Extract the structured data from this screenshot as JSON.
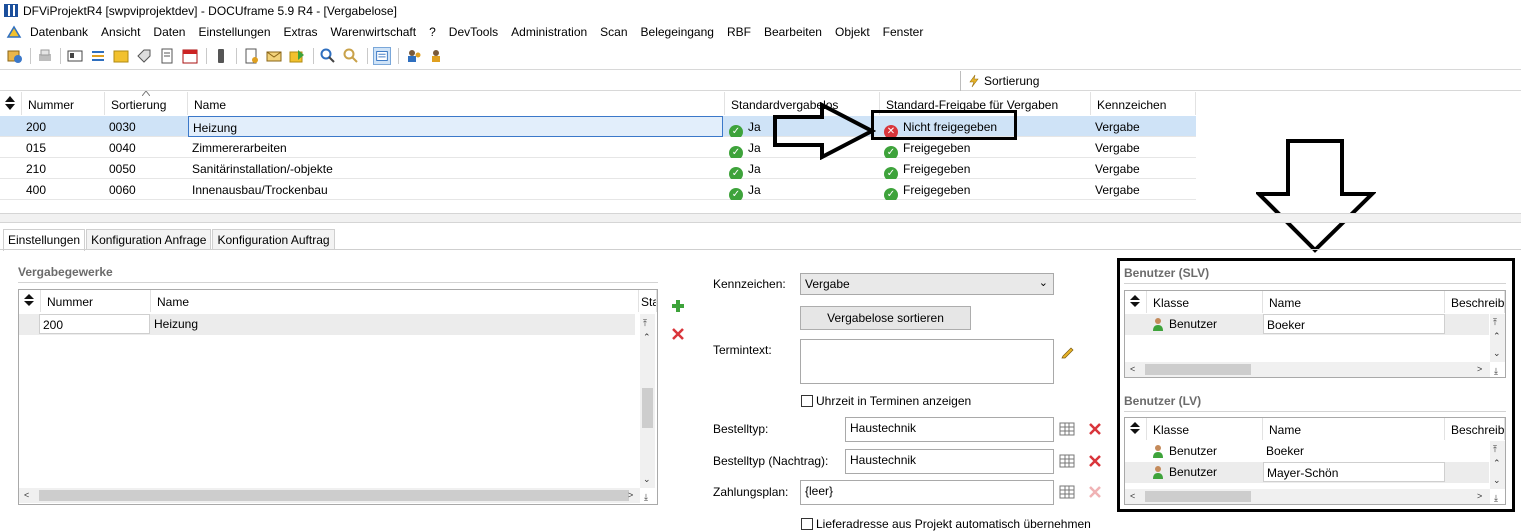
{
  "window": {
    "title": "DFViProjektR4 [swpviprojektdev] - DOCUframe 5.9 R4 - [Vergabelose]"
  },
  "menu": [
    "Datenbank",
    "Ansicht",
    "Daten",
    "Einstellungen",
    "Extras",
    "Warenwirtschaft",
    "?",
    "DevTools",
    "Administration",
    "Scan",
    "Belegeingang",
    "RBF",
    "Bearbeiten",
    "Objekt",
    "Fenster"
  ],
  "sortbar": {
    "label": "Sortierung"
  },
  "grid": {
    "columns": [
      "Nummer",
      "Sortierung",
      "Name",
      "Standardvergabelos",
      "Standard-Freigabe für Vergaben",
      "Kennzeichen"
    ],
    "rows": [
      {
        "nummer": "200",
        "sortierung": "0030",
        "name": "Heizung",
        "std": "Ja",
        "freigabe": "Nicht freigegeben",
        "kennzeichen": "Vergabe"
      },
      {
        "nummer": "015",
        "sortierung": "0040",
        "name": "Zimmererarbeiten",
        "std": "Ja",
        "freigabe": "Freigegeben",
        "kennzeichen": "Vergabe"
      },
      {
        "nummer": "210",
        "sortierung": "0050",
        "name": "Sanitärinstallation/-objekte",
        "std": "Ja",
        "freigabe": "Freigegeben",
        "kennzeichen": "Vergabe"
      },
      {
        "nummer": "400",
        "sortierung": "0060",
        "name": "Innenausbau/Trockenbau",
        "std": "Ja",
        "freigabe": "Freigegeben",
        "kennzeichen": "Vergabe"
      }
    ]
  },
  "tabs": [
    "Einstellungen",
    "Konfiguration Anfrage",
    "Konfiguration Auftrag"
  ],
  "vergabegewerke": {
    "title": "Vergabegewerke",
    "columns": [
      "Nummer",
      "Name",
      "Sta"
    ],
    "rows": [
      {
        "nummer": "200",
        "name": "Heizung"
      }
    ]
  },
  "form": {
    "kennzeichen_label": "Kennzeichen:",
    "kennzeichen_value": "Vergabe",
    "sort_button": "Vergabelose sortieren",
    "termintext_label": "Termintext:",
    "uhrzeit_label": "Uhrzeit in Terminen anzeigen",
    "bestelltyp_label": "Bestelltyp:",
    "bestelltyp_value": "Haustechnik",
    "bestelltyp_nachtrag_label": "Bestelltyp (Nachtrag):",
    "bestelltyp_nachtrag_value": "Haustechnik",
    "zahlungsplan_label": "Zahlungsplan:",
    "zahlungsplan_value": "{leer}",
    "lieferadresse_label": "Lieferadresse aus Projekt automatisch übernehmen"
  },
  "benutzer_slv": {
    "title": "Benutzer (SLV)",
    "columns": [
      "Klasse",
      "Name",
      "Beschreibu"
    ],
    "rows": [
      {
        "klasse": "Benutzer",
        "name": "Boeker"
      }
    ]
  },
  "benutzer_lv": {
    "title": "Benutzer (LV)",
    "columns": [
      "Klasse",
      "Name",
      "Beschreibu"
    ],
    "rows": [
      {
        "klasse": "Benutzer",
        "name": "Boeker"
      },
      {
        "klasse": "Benutzer",
        "name": "Mayer-Schön"
      }
    ]
  },
  "colors": {
    "selection": "#cfe3f7",
    "ok": "#3ea33b",
    "error": "#d9353b",
    "highlight_border": "#000000"
  }
}
